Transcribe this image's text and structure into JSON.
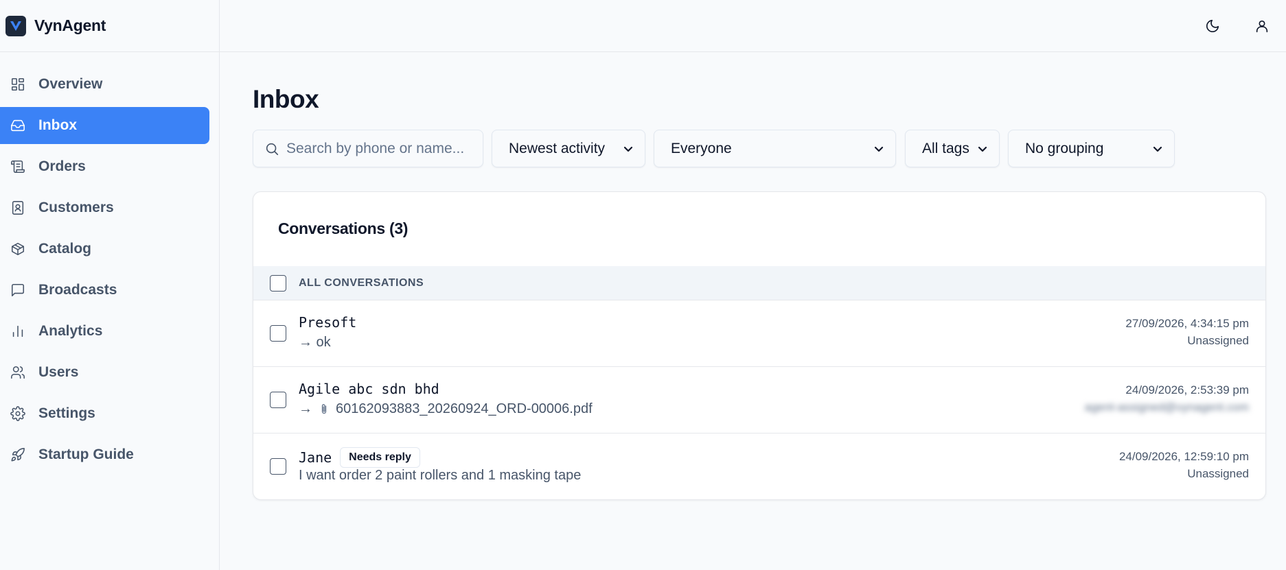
{
  "app": {
    "name": "VynAgent"
  },
  "sidebar": {
    "items": [
      {
        "label": "Overview",
        "icon": "dashboard-icon",
        "active": false
      },
      {
        "label": "Inbox",
        "icon": "inbox-icon",
        "active": true
      },
      {
        "label": "Orders",
        "icon": "receipt-icon",
        "active": false
      },
      {
        "label": "Customers",
        "icon": "contact-book-icon",
        "active": false
      },
      {
        "label": "Catalog",
        "icon": "package-icon",
        "active": false
      },
      {
        "label": "Broadcasts",
        "icon": "message-square-icon",
        "active": false
      },
      {
        "label": "Analytics",
        "icon": "bar-chart-icon",
        "active": false
      },
      {
        "label": "Users",
        "icon": "users-icon",
        "active": false
      },
      {
        "label": "Settings",
        "icon": "gear-icon",
        "active": false
      },
      {
        "label": "Startup Guide",
        "icon": "rocket-icon",
        "active": false
      }
    ]
  },
  "topbar": {
    "icons": [
      "moon-icon",
      "user-icon"
    ]
  },
  "page": {
    "title": "Inbox"
  },
  "filters": {
    "search_placeholder": "Search by phone or name...",
    "sort": "Newest activity",
    "assignee": "Everyone",
    "tags": "All tags",
    "grouping": "No grouping"
  },
  "conversations": {
    "title": "Conversations (3)",
    "header": "ALL CONVERSATIONS",
    "rows": [
      {
        "name": "Presoft",
        "badge": "",
        "preview": "→ ok",
        "attachment": false,
        "timestamp": "27/09/2026, 4:34:15 pm",
        "assignee": "Unassigned",
        "assignee_blurred": false
      },
      {
        "name": "Agile abc sdn bhd",
        "badge": "",
        "preview_arrow": "→",
        "preview": "60162093883_20260924_ORD-00006.pdf",
        "attachment": true,
        "timestamp": "24/09/2026, 2:53:39 pm",
        "assignee": "agent-assigned@vynagent.com",
        "assignee_blurred": true
      },
      {
        "name": "Jane",
        "badge": "Needs reply",
        "preview": "I want order 2 paint rollers and 1 masking tape",
        "attachment": false,
        "timestamp": "24/09/2026, 12:59:10 pm",
        "assignee": "Unassigned",
        "assignee_blurred": false
      }
    ]
  },
  "colors": {
    "accent": "#3b82f6",
    "text": "#0f172a",
    "muted": "#475569",
    "background": "#f8fafc"
  }
}
